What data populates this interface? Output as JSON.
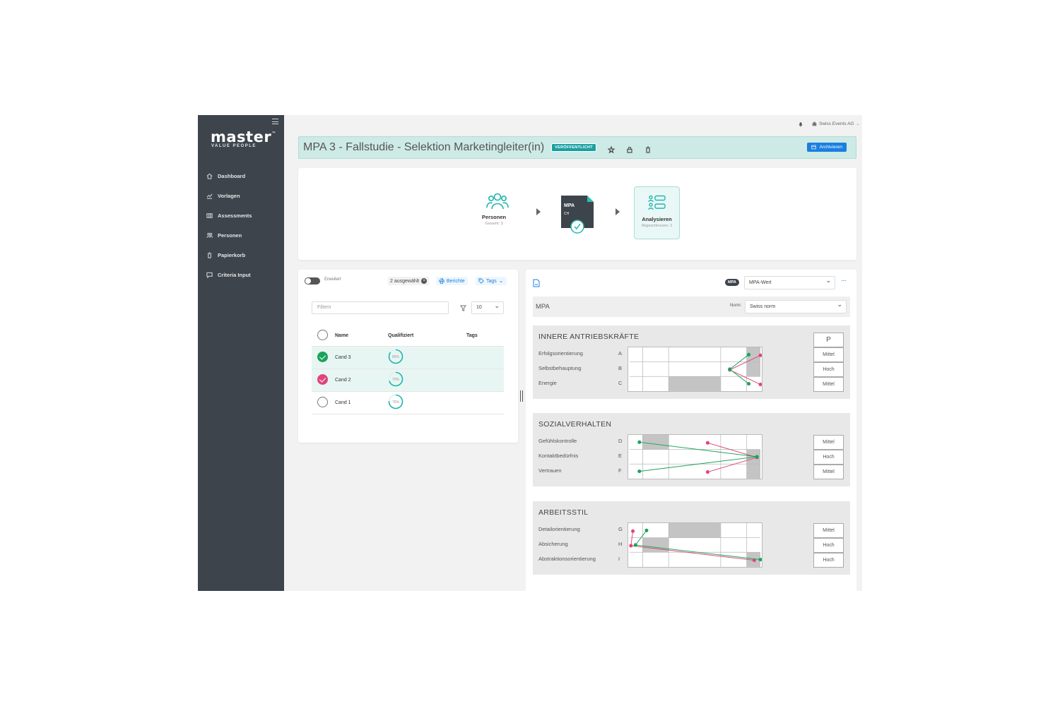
{
  "sidebar": {
    "logo": "master",
    "logo_tm": "™",
    "logo_sub": "VALUE PEOPLE",
    "items": [
      {
        "label": "Dashboard",
        "icon": "home-icon"
      },
      {
        "label": "Vorlagen",
        "icon": "chart-icon"
      },
      {
        "label": "Assessments",
        "icon": "map-icon"
      },
      {
        "label": "Personen",
        "icon": "people-icon"
      },
      {
        "label": "Papierkorb",
        "icon": "trash-icon"
      },
      {
        "label": "Criteria Input",
        "icon": "comment-icon"
      }
    ]
  },
  "topbar": {
    "org": "Swiss Events AG"
  },
  "header": {
    "title": "MPA 3 - Fallstudie - Selektion Marketingleiter(in)",
    "badge": "VERÖFFENTLICHT",
    "archive_label": "Archivieren"
  },
  "workflow": {
    "persons_label": "Personen",
    "persons_sub": "Gesamt: 3",
    "doc_title": "MPA",
    "doc_sub": "CH",
    "analyse_label": "Analysieren",
    "analyse_sub": "Abgeschlossen: 2"
  },
  "candidates": {
    "toggle_label": "Erweitert",
    "selected": "2 ausgewählt",
    "reports_label": "Berichte",
    "tags_label": "Tags",
    "filter_placeholder": "Filtern",
    "page_size": "10",
    "columns": [
      "Name",
      "Qualifiziert",
      "Tags"
    ],
    "rows": [
      {
        "name": "Cand 3",
        "qualified": "85%",
        "qualified_value": 85,
        "state": "checked-green"
      },
      {
        "name": "Cand 2",
        "qualified": "70%",
        "qualified_value": 70,
        "state": "checked-pink"
      },
      {
        "name": "Cand 1",
        "qualified": "76%",
        "qualified_value": 76,
        "state": "unchecked"
      }
    ]
  },
  "results": {
    "mpa_chip": "MPA",
    "value_select": "MPA-Wert",
    "mpa_label": "MPA",
    "norm_label": "Norm:",
    "norm_value": "Swiss norm",
    "p_header": "P",
    "colors": {
      "green": "#1aa35a",
      "pink": "#e0457b",
      "accent": "#1a7fe0"
    },
    "sections": [
      {
        "title": "INNERE ANTRIEBSKRÄFTE",
        "rows": [
          {
            "label": "Erfolgsorientierung",
            "letter": "A",
            "p": "Mittel",
            "band": 4,
            "green": 4.15,
            "pink": 5.05
          },
          {
            "label": "Selbstbehauptung",
            "letter": "B",
            "p": "Hoch",
            "band": 4,
            "green": 3.35,
            "pink": 3.35
          },
          {
            "label": "Energie",
            "letter": "C",
            "p": "Mittel",
            "band": 2,
            "green": 4.15,
            "pink": 5.45
          }
        ]
      },
      {
        "title": "SOZIALVERHALTEN",
        "rows": [
          {
            "label": "Gefühlskontrolle",
            "letter": "D",
            "p": "Mittel",
            "band": 1,
            "green": 0.75,
            "pink": 2.75
          },
          {
            "label": "Kontaktbedürfnis",
            "letter": "E",
            "p": "Hoch",
            "band": 4,
            "green": 4.75,
            "pink": 4.75
          },
          {
            "label": "Vertrauen",
            "letter": "F",
            "p": "Mittel",
            "band": 4,
            "green": 0.75,
            "pink": 2.75
          }
        ]
      },
      {
        "title": "ARBEITSSTIL",
        "rows": [
          {
            "label": "Detailorientierung",
            "letter": "G",
            "p": "Mittel",
            "band": 2,
            "green": 1.15,
            "pink": 0.25
          },
          {
            "label": "Absicherung",
            "letter": "H",
            "p": "Hoch",
            "band": 1,
            "green": 0.45,
            "pink": 0.1
          },
          {
            "label": "Abstraktionsorientierung",
            "letter": "I",
            "p": "Hoch",
            "band": 4,
            "green": 5.05,
            "pink": 4.55
          }
        ]
      }
    ]
  }
}
